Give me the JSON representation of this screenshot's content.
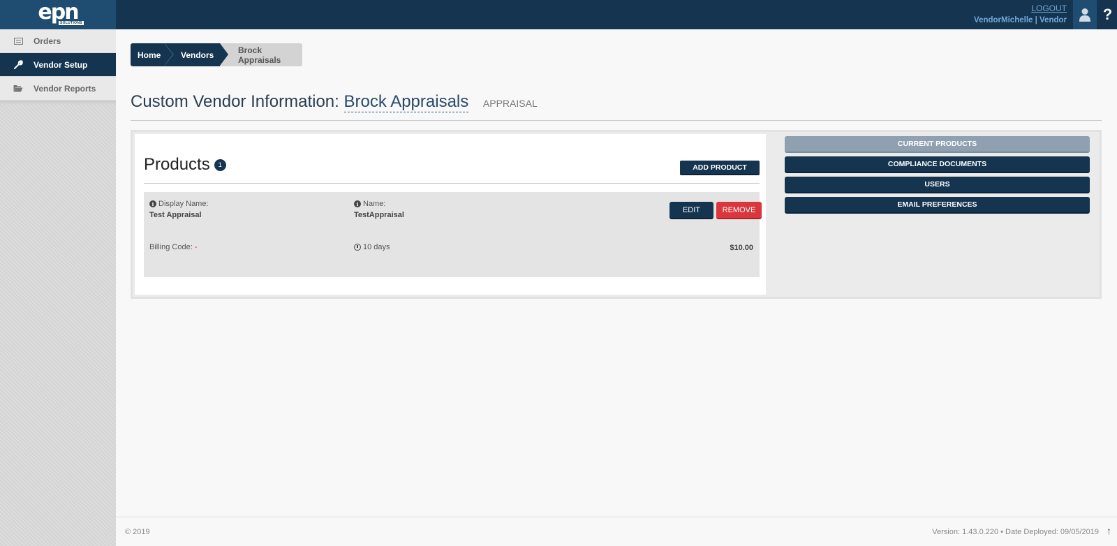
{
  "header": {
    "logo_text": "epn",
    "logo_sub": "SOLUTIONS",
    "logout_label": "LOGOUT",
    "username": "VendorMichelle",
    "role": "Vendor"
  },
  "sidebar": {
    "items": [
      {
        "label": "Orders",
        "icon": "list-icon"
      },
      {
        "label": "Vendor Setup",
        "icon": "wrench-icon"
      },
      {
        "label": "Vendor Reports",
        "icon": "folder-open-icon"
      }
    ]
  },
  "breadcrumb": [
    "Home",
    "Vendors",
    "Brock Appraisals"
  ],
  "page": {
    "title_prefix": "Custom Vendor Information:",
    "vendor_name": "Brock Appraisals",
    "vendor_type": "APPRAISAL"
  },
  "products": {
    "title": "Products",
    "count": "1",
    "add_label": "ADD PRODUCT",
    "items": [
      {
        "display_name_label": "Display Name:",
        "display_name": "Test Appraisal",
        "name_label": "Name:",
        "name": "TestAppraisal",
        "billing_code_label": "Billing Code:",
        "billing_code": "-",
        "turnaround": "10 days",
        "price": "$10.00",
        "edit_label": "EDIT",
        "remove_label": "REMOVE"
      }
    ]
  },
  "tabs": [
    "CURRENT PRODUCTS",
    "COMPLIANCE DOCUMENTS",
    "USERS",
    "EMAIL PREFERENCES"
  ],
  "footer": {
    "copyright": "© 2019",
    "version": "Version: 1.43.0.220  •  Date Deployed: 09/05/2019"
  },
  "colors": {
    "navy": "#15344f",
    "header_accent": "#1f4d72",
    "danger": "#d9363e",
    "tab_current": "#8fa1b1"
  }
}
